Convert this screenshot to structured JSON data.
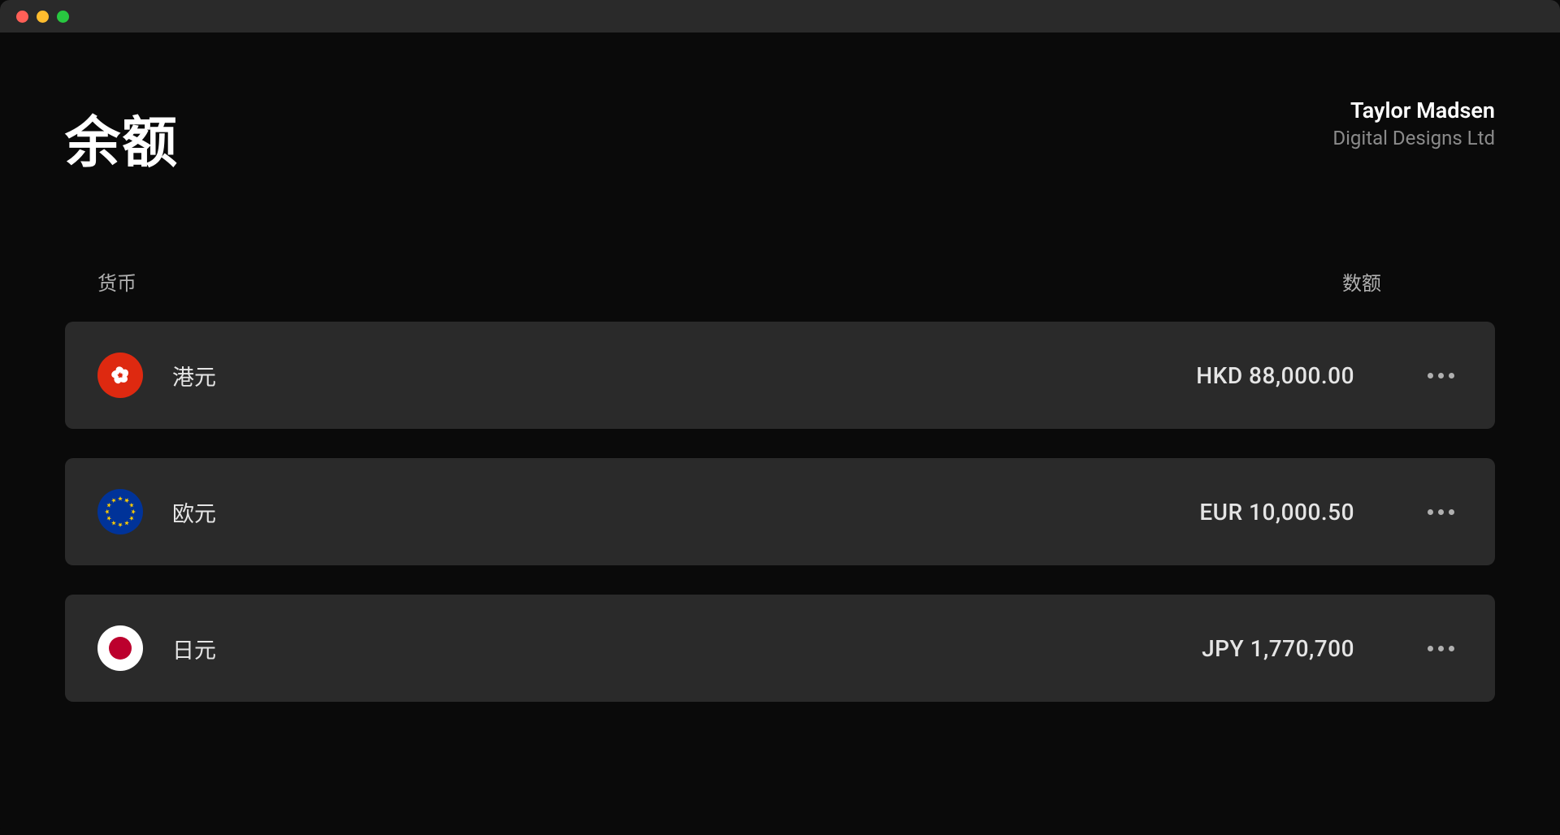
{
  "header": {
    "title": "余额",
    "user_name": "Taylor Madsen",
    "user_company": "Digital Designs Ltd"
  },
  "table": {
    "columns": {
      "currency": "货币",
      "amount": "数额"
    }
  },
  "balances": [
    {
      "flag": "hk",
      "currency_name": "港元",
      "amount": "HKD 88,000.00"
    },
    {
      "flag": "eu",
      "currency_name": "欧元",
      "amount": "EUR 10,000.50"
    },
    {
      "flag": "jp",
      "currency_name": "日元",
      "amount": "JPY 1,770,700"
    }
  ]
}
